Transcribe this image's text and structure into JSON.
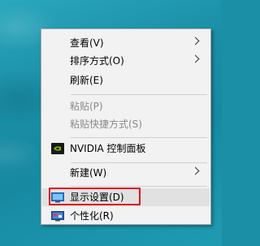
{
  "menu": {
    "items": [
      {
        "label": "查看(V)"
      },
      {
        "label": "排序方式(O)"
      },
      {
        "label": "刷新(E)"
      },
      {
        "label": "粘贴(P)"
      },
      {
        "label": "粘贴快捷方式(S)"
      },
      {
        "label": "NVIDIA 控制面板"
      },
      {
        "label": "新建(W)"
      },
      {
        "label": "显示设置(D)"
      },
      {
        "label": "个性化(R)"
      }
    ]
  },
  "colors": {
    "highlight_border": "#e0101a",
    "nvidia_green": "#76b900"
  }
}
